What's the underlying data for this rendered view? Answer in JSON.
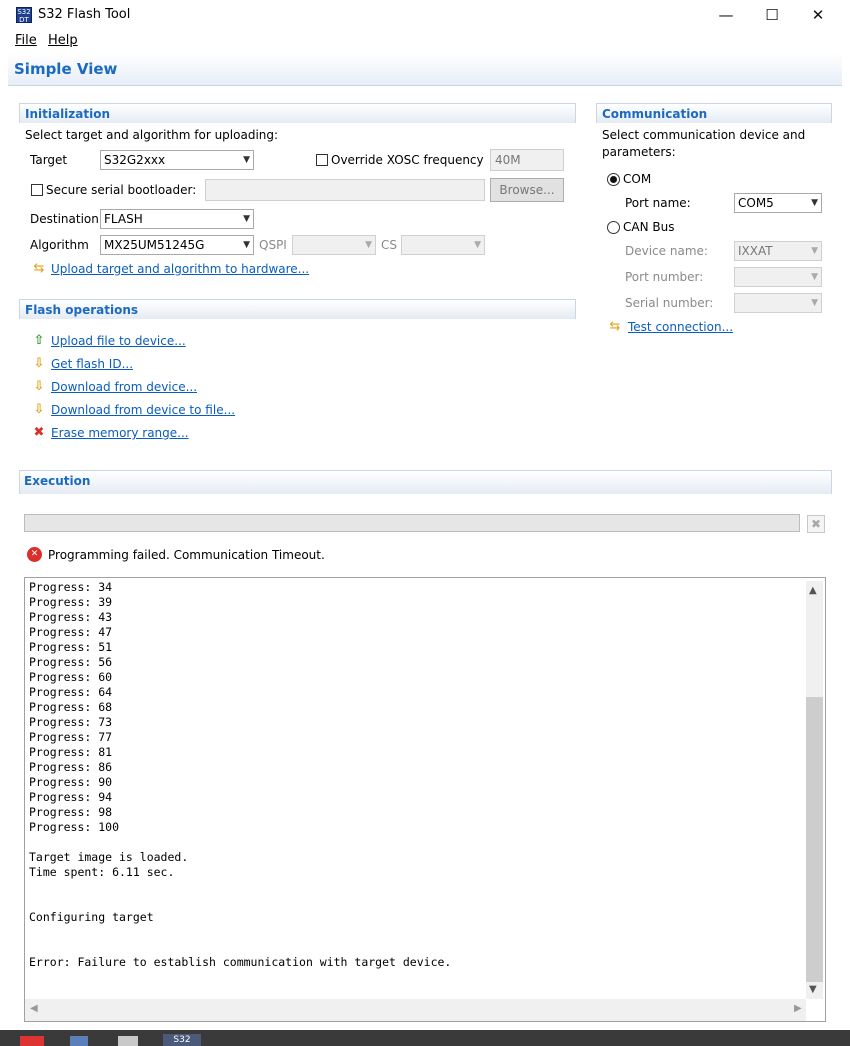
{
  "window": {
    "title": "S32 Flash Tool",
    "app_icon_text": "S32\nDT",
    "minimize": "—",
    "maximize": "☐",
    "close": "✕"
  },
  "menu": {
    "file": "File",
    "help": "Help"
  },
  "view": {
    "title": "Simple View"
  },
  "initialization": {
    "title": "Initialization",
    "instruction": "Select target and algorithm for uploading:",
    "target_label": "Target",
    "target_value": "S32G2xxx",
    "override_label": "Override XOSC frequency",
    "override_checked": false,
    "xosc_value": "40M",
    "secure_label": "Secure serial bootloader:",
    "secure_checked": false,
    "secure_path": "",
    "browse_label": "Browse...",
    "destination_label": "Destination",
    "destination_value": "FLASH",
    "algorithm_label": "Algorithm",
    "algorithm_value": "MX25UM51245G",
    "qspi_label": "QSPI",
    "qspi_value": "",
    "cs_label": "CS",
    "cs_value": "",
    "upload_link": "Upload target and algorithm to hardware..."
  },
  "flash_operations": {
    "title": "Flash operations",
    "items": [
      {
        "label": "Upload file to device...",
        "icon": "arrow-up-icon",
        "color": "#3c9a3c"
      },
      {
        "label": "Get flash ID...",
        "icon": "arrow-down-icon",
        "color": "#e0a21a"
      },
      {
        "label": "Download from device...",
        "icon": "arrow-down-icon",
        "color": "#e0a21a"
      },
      {
        "label": "Download from device to file...",
        "icon": "arrow-down-icon",
        "color": "#e0a21a"
      },
      {
        "label": "Erase memory range...",
        "icon": "red-x-icon",
        "color": "#d9302c"
      }
    ]
  },
  "communication": {
    "title": "Communication",
    "instruction": "Select communication device and parameters:",
    "com_label": "COM",
    "com_selected": true,
    "port_name_label": "Port name:",
    "port_name_value": "COM5",
    "can_label": "CAN Bus",
    "can_selected": false,
    "device_name_label": "Device name:",
    "device_name_value": "IXXAT",
    "port_number_label": "Port number:",
    "port_number_value": "",
    "serial_number_label": "Serial number:",
    "serial_number_value": "",
    "test_link": "Test connection..."
  },
  "execution": {
    "title": "Execution",
    "status": "Programming failed. Communication Timeout.",
    "progress": 0,
    "console_lines": [
      "Progress: 34",
      "Progress: 39",
      "Progress: 43",
      "Progress: 47",
      "Progress: 51",
      "Progress: 56",
      "Progress: 60",
      "Progress: 64",
      "Progress: 68",
      "Progress: 73",
      "Progress: 77",
      "Progress: 81",
      "Progress: 86",
      "Progress: 90",
      "Progress: 94",
      "Progress: 98",
      "Progress: 100",
      "",
      "Target image is loaded.",
      "Time spent: 6.11 sec.",
      "",
      "",
      "Configuring target",
      "",
      "",
      "Error: Failure to establish communication with target device."
    ]
  },
  "colors": {
    "accent": "#1b6ac2",
    "link": "#0a5dbd",
    "error": "#d9302c"
  },
  "taskbar": {
    "active_app_label": "S32"
  }
}
